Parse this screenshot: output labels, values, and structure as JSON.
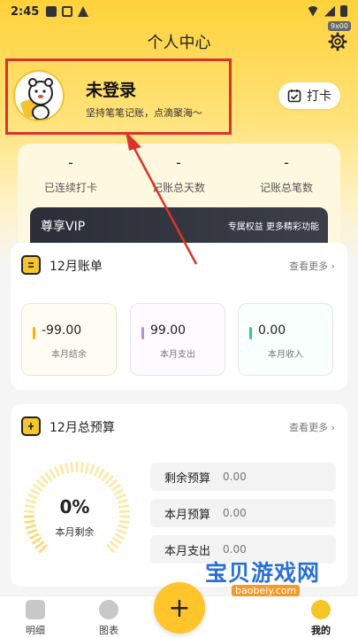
{
  "status_bar": {
    "time": "2:45"
  },
  "header": {
    "title": "个人中心",
    "settings_badge": "9x00"
  },
  "profile": {
    "name": "未登录",
    "slogan": "坚持笔笔记账，点滴聚海～"
  },
  "checkin": {
    "label": "打卡"
  },
  "stats": [
    {
      "value": "-",
      "label": "已连续打卡"
    },
    {
      "value": "-",
      "label": "记账总天数"
    },
    {
      "value": "-",
      "label": "记账总笔数"
    }
  ],
  "vip": {
    "title": "尊享VIP",
    "desc": "专属权益 更多精彩功能"
  },
  "bill": {
    "title": "12月账单",
    "more": "查看更多 ›",
    "items": [
      {
        "value": "-99.00",
        "label": "本月结余",
        "color": "#f5b400"
      },
      {
        "value": "99.00",
        "label": "本月支出",
        "color": "#b88be0"
      },
      {
        "value": "0.00",
        "label": "本月收入",
        "color": "#2ec9a0"
      }
    ]
  },
  "budget": {
    "title": "12月总预算",
    "more": "查看更多 ›",
    "percent": "0%",
    "percent_label": "本月剩余",
    "rows": [
      {
        "label": "剩余预算",
        "value": "0.00"
      },
      {
        "label": "本月预算",
        "value": "0.00"
      },
      {
        "label": "本月支出",
        "value": "0.00"
      }
    ]
  },
  "tabbar": {
    "tabs": [
      {
        "label": "明细"
      },
      {
        "label": "图表"
      },
      {
        "label": "我的"
      }
    ]
  },
  "watermark": {
    "text": "宝贝游戏网",
    "url": "baobeiy.com"
  },
  "colors": {
    "accent": "#ffc52a",
    "highlight_border": "#d9342b"
  }
}
